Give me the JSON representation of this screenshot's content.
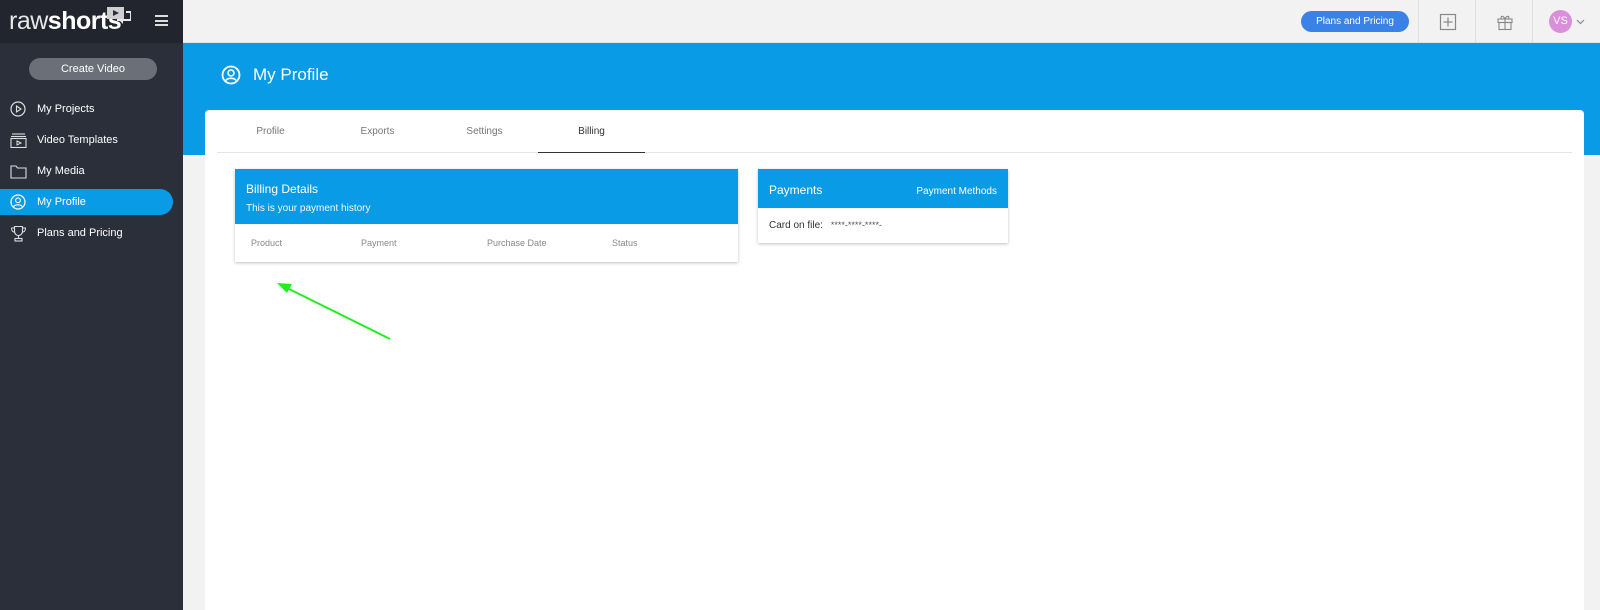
{
  "brand": {
    "logo_raw": "raw",
    "logo_shorts": "shorts"
  },
  "sidebar": {
    "create_label": "Create Video",
    "items": [
      {
        "label": "My Projects",
        "icon": "play-circle-icon"
      },
      {
        "label": "Video Templates",
        "icon": "template-icon"
      },
      {
        "label": "My Media",
        "icon": "folder-icon"
      },
      {
        "label": "My Profile",
        "icon": "user-circle-icon",
        "active": true
      },
      {
        "label": "Plans and Pricing",
        "icon": "trophy-icon"
      }
    ]
  },
  "topbar": {
    "pricing_label": "Plans and Pricing",
    "avatar_initials": "VS"
  },
  "header": {
    "title": "My Profile"
  },
  "tabs": [
    {
      "label": "Profile"
    },
    {
      "label": "Exports"
    },
    {
      "label": "Settings"
    },
    {
      "label": "Billing",
      "active": true
    }
  ],
  "billing": {
    "title": "Billing Details",
    "subtitle": "This is your payment history",
    "columns": [
      "Product",
      "Payment",
      "Purchase Date",
      "Status"
    ]
  },
  "payments": {
    "title": "Payments",
    "link_label": "Payment Methods",
    "card_label": "Card on file:",
    "card_number": "****-****-****-"
  },
  "colors": {
    "accent": "#0a9be6",
    "sidebar": "#2b2f3a",
    "annotation_arrow": "#22ee22"
  }
}
